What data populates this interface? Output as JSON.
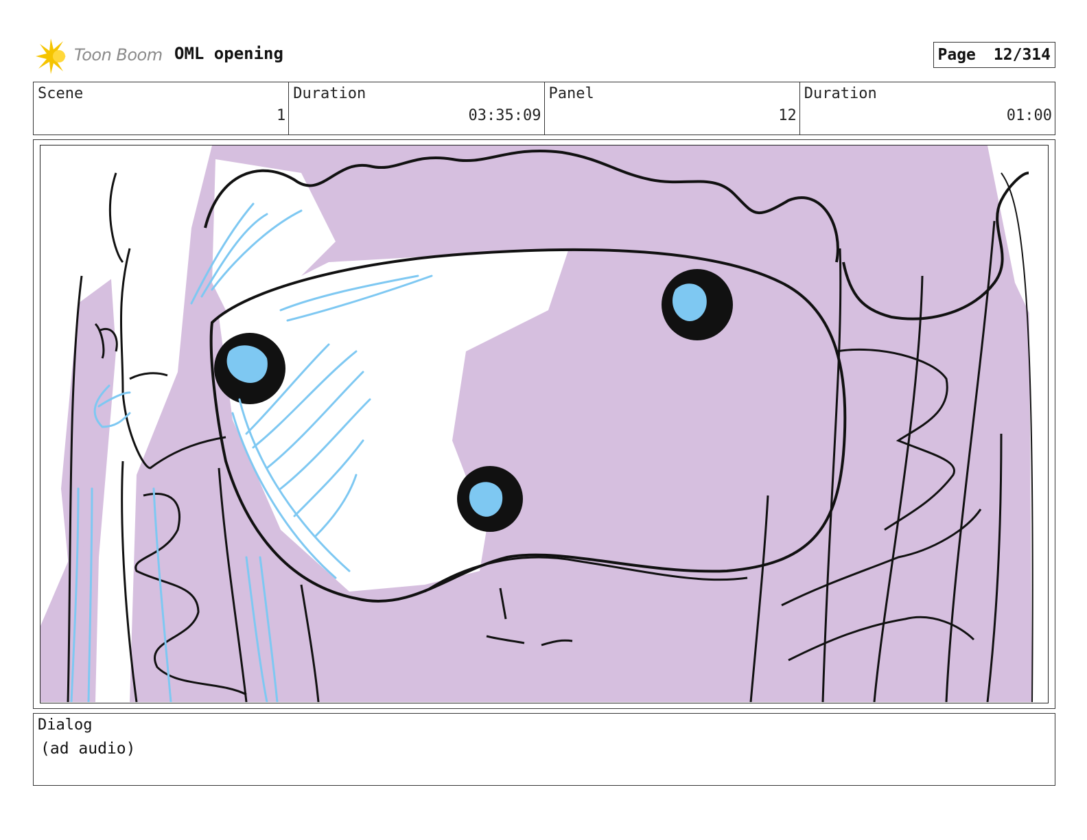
{
  "header": {
    "logo_text": "Toon Boom",
    "project_title": "OML opening",
    "page_label": "Page",
    "page_value": "12/314"
  },
  "info": {
    "scene_label": "Scene",
    "scene_value": "1",
    "scene_duration_label": "Duration",
    "scene_duration_value": "03:35:09",
    "panel_label": "Panel",
    "panel_value": "12",
    "panel_duration_label": "Duration",
    "panel_duration_value": "01:00"
  },
  "dialog": {
    "label": "Dialog",
    "text": "(ad audio)"
  },
  "colors": {
    "lavender": "#d6bfdf",
    "sketch_blue": "#7ec8f2",
    "logo_yellow": "#f5c400",
    "line": "#111111"
  }
}
